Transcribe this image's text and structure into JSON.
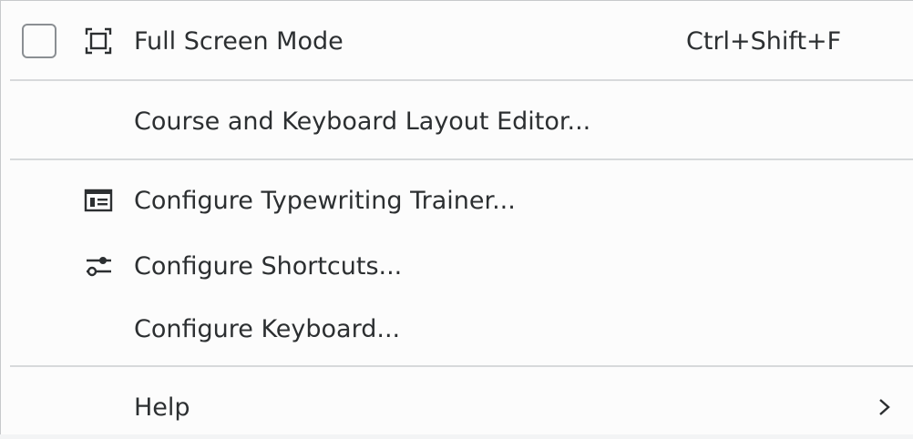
{
  "menu": {
    "items": [
      {
        "label": "Full Screen Mode",
        "shortcut": "Ctrl+Shift+F",
        "icon": "fullscreen-icon",
        "checkable": true,
        "checked": false
      },
      {
        "label": "Course and Keyboard Layout Editor..."
      },
      {
        "label": "Configure Typewriting Trainer...",
        "icon": "configure-trainer-icon"
      },
      {
        "label": "Configure Shortcuts...",
        "icon": "configure-shortcuts-icon"
      },
      {
        "label": "Configure Keyboard..."
      },
      {
        "label": "Help",
        "submenu": true,
        "icon": "chevron-right-icon"
      }
    ]
  },
  "colors": {
    "background": "#fcfcfc",
    "text": "#2c2f31",
    "separator": "#d7d9db",
    "checkbox_border": "#8b8f93"
  }
}
